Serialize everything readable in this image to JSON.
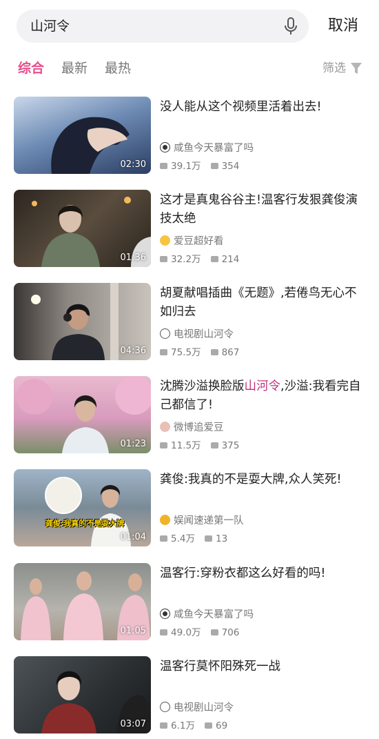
{
  "search": {
    "query": "山河令",
    "cancel_label": "取消"
  },
  "tabs": [
    {
      "label": "综合",
      "active": true
    },
    {
      "label": "最新",
      "active": false
    },
    {
      "label": "最热",
      "active": false
    }
  ],
  "filter_label": "筛选",
  "accent_color": "#e94f8e",
  "videos": [
    {
      "title": "没人能从这个视频里活着出去!",
      "duration": "02:30",
      "author": "咸鱼今天暴富了吗",
      "plays": "39.1万",
      "comments": "354"
    },
    {
      "title": "这才是真鬼谷谷主!温客行发狠龚俊演技太绝",
      "duration": "01:36",
      "author": "爱豆超好看",
      "plays": "32.2万",
      "comments": "214"
    },
    {
      "title": "胡夏献唱插曲《无题》,若倦鸟无心不如归去",
      "duration": "04:36",
      "author": "电视剧山河令",
      "plays": "75.5万",
      "comments": "867"
    },
    {
      "title_before": "沈腾沙溢换脸版",
      "title_highlight": "山河令",
      "title_after": ",沙溢:我看完自己都信了!",
      "duration": "01:23",
      "author": "微博追爱豆",
      "plays": "11.5万",
      "comments": "375"
    },
    {
      "title": "龚俊:我真的不是耍大牌,众人笑死!",
      "duration": "01:04",
      "author": "娱闻速递第一队",
      "plays": "5.4万",
      "comments": "13",
      "thumb_caption": "龚俊:我真的不是耍大牌"
    },
    {
      "title": "温客行:穿粉衣都这么好看的吗!",
      "duration": "01:05",
      "author": "咸鱼今天暴富了吗",
      "plays": "49.0万",
      "comments": "706"
    },
    {
      "title": "温客行莫怀阳殊死一战",
      "duration": "03:07",
      "author": "电视剧山河令",
      "plays": "6.1万",
      "comments": "69"
    }
  ]
}
